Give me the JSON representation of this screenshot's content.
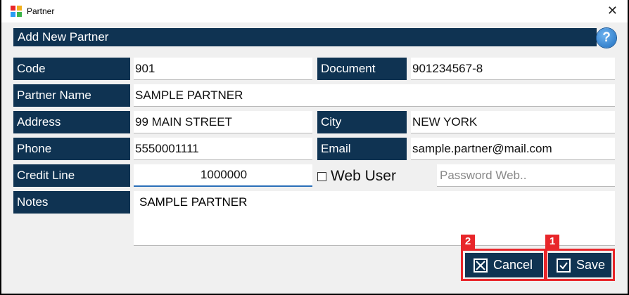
{
  "window": {
    "title": "Partner"
  },
  "header": {
    "title": "Add New Partner",
    "help": "?"
  },
  "labels": {
    "code": "Code",
    "document": "Document",
    "partner_name": "Partner Name",
    "address": "Address",
    "city": "City",
    "phone": "Phone",
    "email": "Email",
    "credit_line": "Credit Line",
    "notes": "Notes"
  },
  "values": {
    "code": "901",
    "document": "901234567-8",
    "partner_name": "SAMPLE PARTNER",
    "address": "99 MAIN STREET",
    "city": "NEW YORK",
    "phone": "5550001111",
    "email": "sample.partner@mail.com",
    "credit_line": "1000000",
    "notes": "SAMPLE PARTNER"
  },
  "web_user": {
    "label": "Web User",
    "checked": false
  },
  "password_web": {
    "placeholder": "Password Web.."
  },
  "buttons": {
    "cancel": "Cancel",
    "save": "Save"
  },
  "badges": {
    "save": "1",
    "cancel": "2"
  },
  "colors": {
    "label_bg": "#0f3352",
    "highlight": "#e8262a",
    "help": "#1f6fc0"
  }
}
